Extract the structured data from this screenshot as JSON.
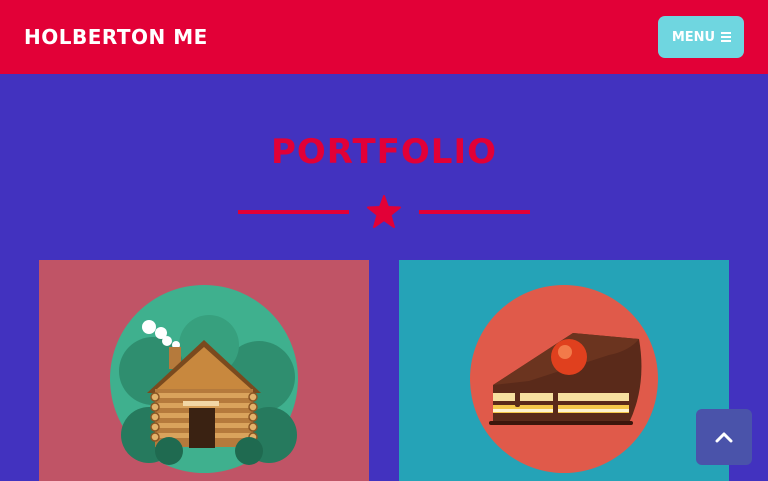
{
  "navbar": {
    "brand": "HOLBERTON ME",
    "menu_label": "MENU",
    "menu_icon": "bars-icon",
    "background": "#e20037"
  },
  "portfolio": {
    "title": "PORTFOLIO",
    "divider_icon": "star-icon",
    "accent": "#e20037",
    "items": [
      {
        "image": "log-cabin-illustration",
        "background": "#c05466"
      },
      {
        "image": "cake-slice-illustration",
        "background": "#25a3b7"
      }
    ]
  },
  "back_to_top": {
    "icon": "chevron-up-icon",
    "background": "#4a53aa"
  },
  "page": {
    "background": "#4232bf"
  }
}
